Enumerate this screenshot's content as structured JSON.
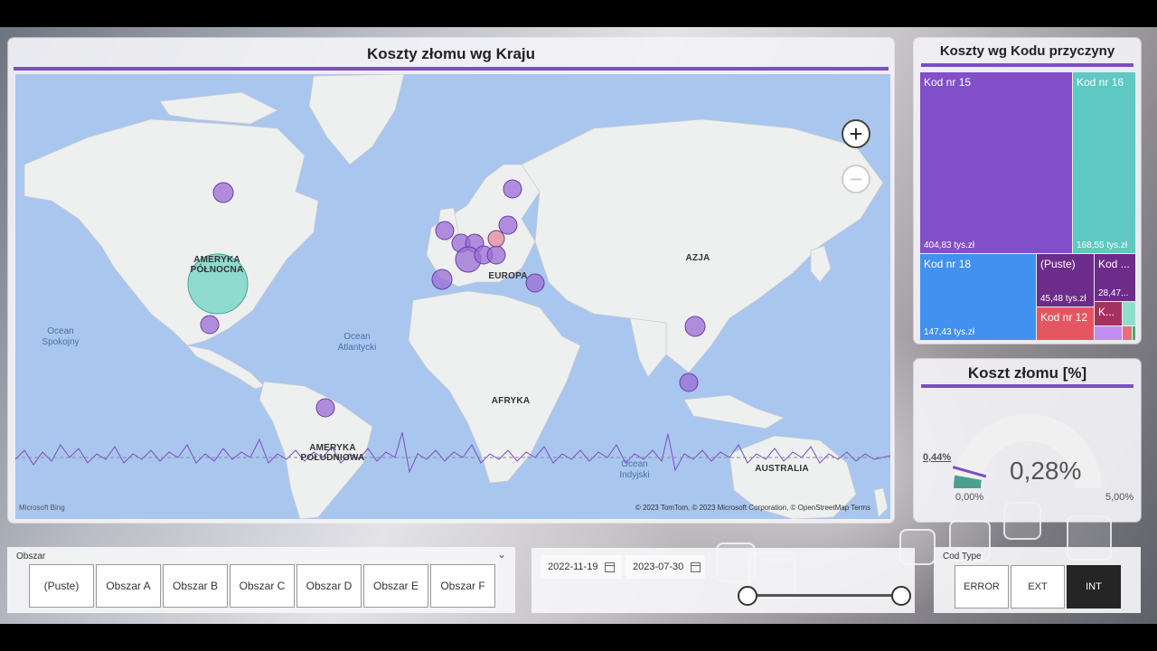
{
  "map": {
    "title": "Koszty złomu wg Kraju",
    "continents": {
      "north_america": "AMERYKA\nPÓŁNOCNA",
      "south_america": "AMERYKA\nPOŁUDNIOWA",
      "europe": "EUROPA",
      "asia": "AZJA",
      "africa": "AFRYKA",
      "australia": "AUSTRALIA"
    },
    "oceans": {
      "pacific": "Ocean\nSpokojny",
      "atlantic": "Ocean\nAtlantycki",
      "indian": "Ocean\nIndyjski"
    },
    "zoom_in": "+",
    "zoom_out": "−",
    "provider": "Microsoft Bing",
    "copyright": "© 2023 TomTom, © 2023 Microsoft Corporation, © OpenStreetMap  Terms",
    "bubble_colors": {
      "default": "#9b6cd6",
      "large": "#6fd3c4",
      "highlight": "#e58a9a"
    }
  },
  "treemap": {
    "title": "Koszty wg Kodu przyczyny",
    "items": [
      {
        "name": "Kod nr 15",
        "value": "404,83 tys.zł",
        "color": "#8150c8"
      },
      {
        "name": "Kod nr 16",
        "value": "168,55 tys.zł",
        "color": "#5ec8c2"
      },
      {
        "name": "Kod nr 18",
        "value": "147,43 tys.zł",
        "color": "#4191f1"
      },
      {
        "name": "(Puste)",
        "value": "45,48 tys.zł",
        "color": "#6d2c8a"
      },
      {
        "name": "Kod ...",
        "value": "28,47...",
        "color": "#6d2c8a"
      },
      {
        "name": "Kod nr 12",
        "value": "",
        "color": "#e45762"
      },
      {
        "name": "K...",
        "value": "",
        "color": "#a3335e"
      }
    ]
  },
  "gauge": {
    "title": "Koszt złomu [%]",
    "value_label": "0,28%",
    "value": 0.28,
    "target_label": "0,44%",
    "target": 0.44,
    "min_label": "0,00%",
    "max_label": "5,00%",
    "min": 0,
    "max": 5,
    "fill_color": "#4aa08f",
    "track_color": "#f0f0f0",
    "target_color": "#7a4fc4"
  },
  "area_slicer": {
    "title": "Obszar",
    "options": [
      "(Puste)",
      "Obszar A",
      "Obszar B",
      "Obszar C",
      "Obszar D",
      "Obszar E",
      "Obszar F"
    ]
  },
  "date_slicer": {
    "start": "2022-11-19",
    "end": "2023-07-30"
  },
  "cod_slicer": {
    "title": "Cod Type",
    "options": [
      "ERROR",
      "EXT",
      "INT"
    ],
    "selected": "INT"
  }
}
